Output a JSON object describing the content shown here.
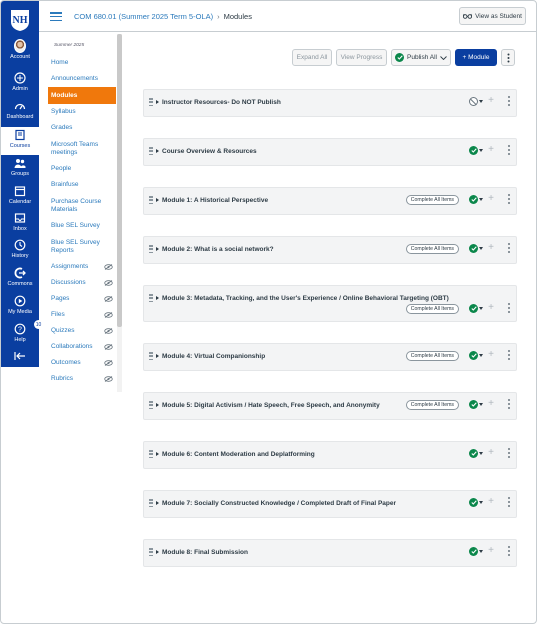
{
  "header": {
    "breadcrumb_course": "COM 680.01 (Summer 2025 Term 5-OLA)",
    "breadcrumb_separator": "›",
    "breadcrumb_page": "Modules",
    "view_as_student": "View as Student"
  },
  "global_nav": [
    {
      "label": "Account",
      "icon": "avatar"
    },
    {
      "label": "Admin",
      "icon": "shield-icon"
    },
    {
      "label": "Dashboard",
      "icon": "dashboard-icon"
    },
    {
      "label": "Courses",
      "icon": "book-icon",
      "active": true
    },
    {
      "label": "Groups",
      "icon": "groups-icon"
    },
    {
      "label": "Calendar",
      "icon": "calendar-icon"
    },
    {
      "label": "Inbox",
      "icon": "inbox-icon"
    },
    {
      "label": "History",
      "icon": "clock-icon"
    },
    {
      "label": "Commons",
      "icon": "commons-icon"
    },
    {
      "label": "My Media",
      "icon": "media-icon"
    },
    {
      "label": "Help",
      "icon": "help-icon",
      "badge": "10"
    }
  ],
  "course_nav": {
    "term": "Summer 2025",
    "items": [
      {
        "label": "Home"
      },
      {
        "label": "Announcements"
      },
      {
        "label": "Modules",
        "active": true
      },
      {
        "label": "Syllabus"
      },
      {
        "label": "Grades"
      },
      {
        "label": "Microsoft Teams meetings"
      },
      {
        "label": "People"
      },
      {
        "label": "Brainfuse"
      },
      {
        "label": "Purchase Course Materials"
      },
      {
        "label": "Blue SEL Survey"
      },
      {
        "label": "Blue SEL Survey Reports"
      },
      {
        "label": "Assignments",
        "hidden": true
      },
      {
        "label": "Discussions",
        "hidden": true
      },
      {
        "label": "Pages",
        "hidden": true
      },
      {
        "label": "Files",
        "hidden": true
      },
      {
        "label": "Quizzes",
        "hidden": true
      },
      {
        "label": "Collaborations",
        "hidden": true
      },
      {
        "label": "Outcomes",
        "hidden": true
      },
      {
        "label": "Rubrics",
        "hidden": true
      }
    ]
  },
  "toolbar": {
    "expand_all": "Expand All",
    "view_progress": "View Progress",
    "publish_all": "Publish All",
    "add_module": "+ Module"
  },
  "modules": [
    {
      "title": "Instructor Resources- Do NOT Publish",
      "published": false,
      "requirement": ""
    },
    {
      "title": "Course Overview & Resources",
      "published": true,
      "requirement": ""
    },
    {
      "title": "Module 1: A Historical Perspective",
      "published": true,
      "requirement": "Complete All Items"
    },
    {
      "title": "Module 2: What is a social network?",
      "published": true,
      "requirement": "Complete All Items"
    },
    {
      "title": "Module 3: Metadata, Tracking, and the User's Experience / Online Behavioral Targeting (OBT)",
      "published": true,
      "requirement": "Complete All Items"
    },
    {
      "title": "Module 4: Virtual Companionship",
      "published": true,
      "requirement": "Complete All Items"
    },
    {
      "title": "Module 5: Digital Activism / Hate Speech, Free Speech, and Anonymity",
      "published": true,
      "requirement": "Complete All Items"
    },
    {
      "title": "Module 6: Content Moderation and Deplatforming",
      "published": true,
      "requirement": ""
    },
    {
      "title": "Module 7: Socially Constructed Knowledge / Completed Draft of Final Paper",
      "published": true,
      "requirement": ""
    },
    {
      "title": "Module 8: Final Submission",
      "published": true,
      "requirement": ""
    }
  ],
  "colors": {
    "brand": "#0a3ea0",
    "active_nav": "#f0780c",
    "published": "#0b874b",
    "link": "#2b7abc"
  }
}
